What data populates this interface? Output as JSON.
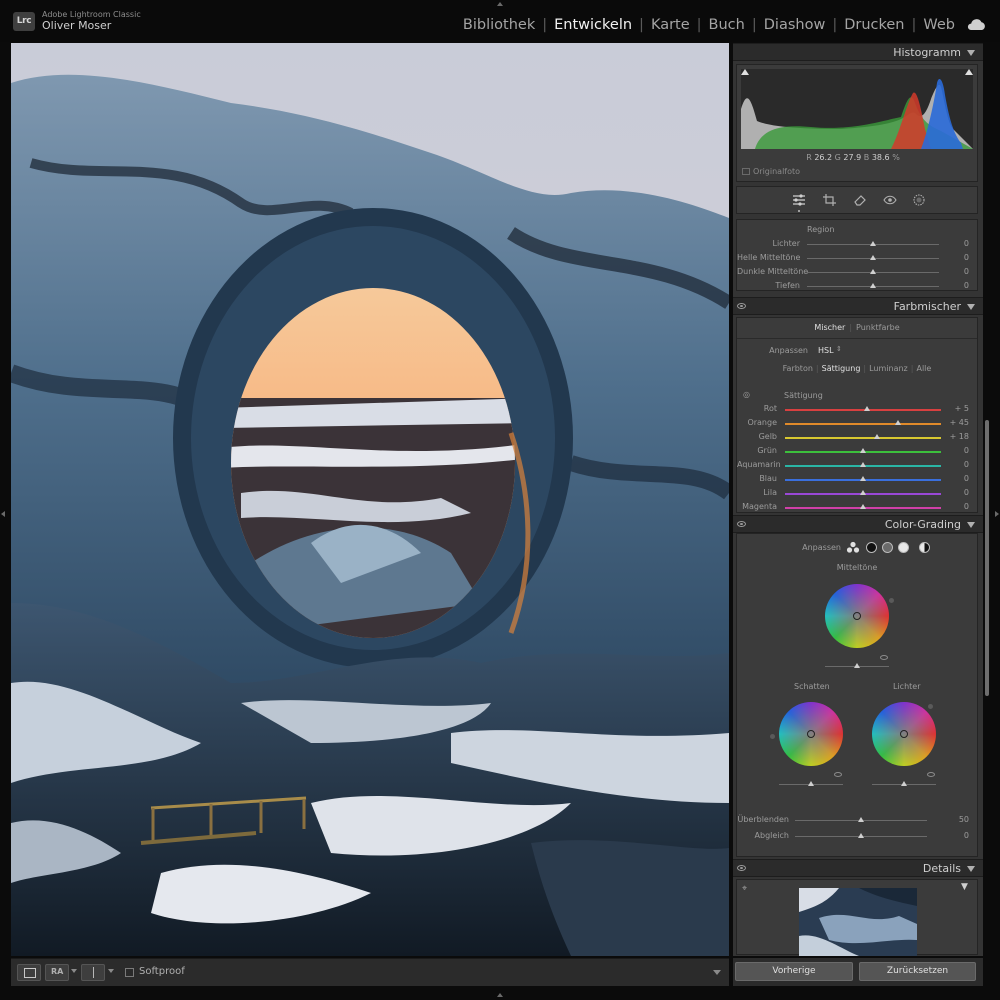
{
  "app": {
    "logo": "Lrc",
    "name": "Adobe Lightroom Classic",
    "user": "Oliver Moser"
  },
  "modules": [
    {
      "label": "Bibliothek",
      "active": false
    },
    {
      "label": "Entwickeln",
      "active": true
    },
    {
      "label": "Karte",
      "active": false
    },
    {
      "label": "Buch",
      "active": false
    },
    {
      "label": "Diashow",
      "active": false
    },
    {
      "label": "Drucken",
      "active": false
    },
    {
      "label": "Web",
      "active": false
    }
  ],
  "icons": {
    "cloud": "cloud-icon",
    "tools": [
      "sliders-icon",
      "crop-icon",
      "eraser-icon",
      "eye-redeye-icon",
      "mask-icon"
    ]
  },
  "histogram": {
    "title": "Histogramm",
    "readout": {
      "r_label": "R",
      "r": "26.2",
      "g_label": "G",
      "g": "27.9",
      "b_label": "B",
      "b": "38.6",
      "unit": "%"
    },
    "original_photo": "Originalfoto"
  },
  "region": {
    "title": "Region",
    "sliders": [
      {
        "label": "Lichter",
        "value": "0",
        "position": 0.5
      },
      {
        "label": "Helle Mitteltöne",
        "value": "0",
        "position": 0.5
      },
      {
        "label": "Dunkle Mitteltöne",
        "value": "0",
        "position": 0.5
      },
      {
        "label": "Tiefen",
        "value": "0",
        "position": 0.5
      }
    ]
  },
  "farbmischer": {
    "title": "Farbmischer",
    "tabs": [
      "Mischer",
      "Punktfarbe"
    ],
    "anpassen_label": "Anpassen",
    "anpassen_value": "HSL",
    "modes": [
      "Farbton",
      "Sättigung",
      "Luminanz",
      "Alle"
    ],
    "section": "Sättigung",
    "sliders": [
      {
        "label": "Rot",
        "value": "+ 5",
        "position": 0.525,
        "color": "#d84040"
      },
      {
        "label": "Orange",
        "value": "+ 45",
        "position": 0.725,
        "color": "#e08a2a"
      },
      {
        "label": "Gelb",
        "value": "+ 18",
        "position": 0.59,
        "color": "#d8c830"
      },
      {
        "label": "Grün",
        "value": "0",
        "position": 0.5,
        "color": "#3cbf3c"
      },
      {
        "label": "Aquamarin",
        "value": "0",
        "position": 0.5,
        "color": "#2ab5a5"
      },
      {
        "label": "Blau",
        "value": "0",
        "position": 0.5,
        "color": "#3a6fdc"
      },
      {
        "label": "Lila",
        "value": "0",
        "position": 0.5,
        "color": "#9a48d6"
      },
      {
        "label": "Magenta",
        "value": "0",
        "position": 0.5,
        "color": "#d040a8"
      }
    ]
  },
  "color_grading": {
    "title": "Color-Grading",
    "anpassen_label": "Anpassen",
    "midtones": "Mitteltöne",
    "shadows": "Schatten",
    "highlights": "Lichter",
    "blend_label": "Überblenden",
    "blend_value": "50",
    "balance_label": "Abgleich",
    "balance_value": "0"
  },
  "details": {
    "title": "Details"
  },
  "toolbar": {
    "softproof": "Softproof",
    "before_after": "RA"
  },
  "buttons": {
    "previous": "Vorherige",
    "reset": "Zurücksetzen"
  }
}
